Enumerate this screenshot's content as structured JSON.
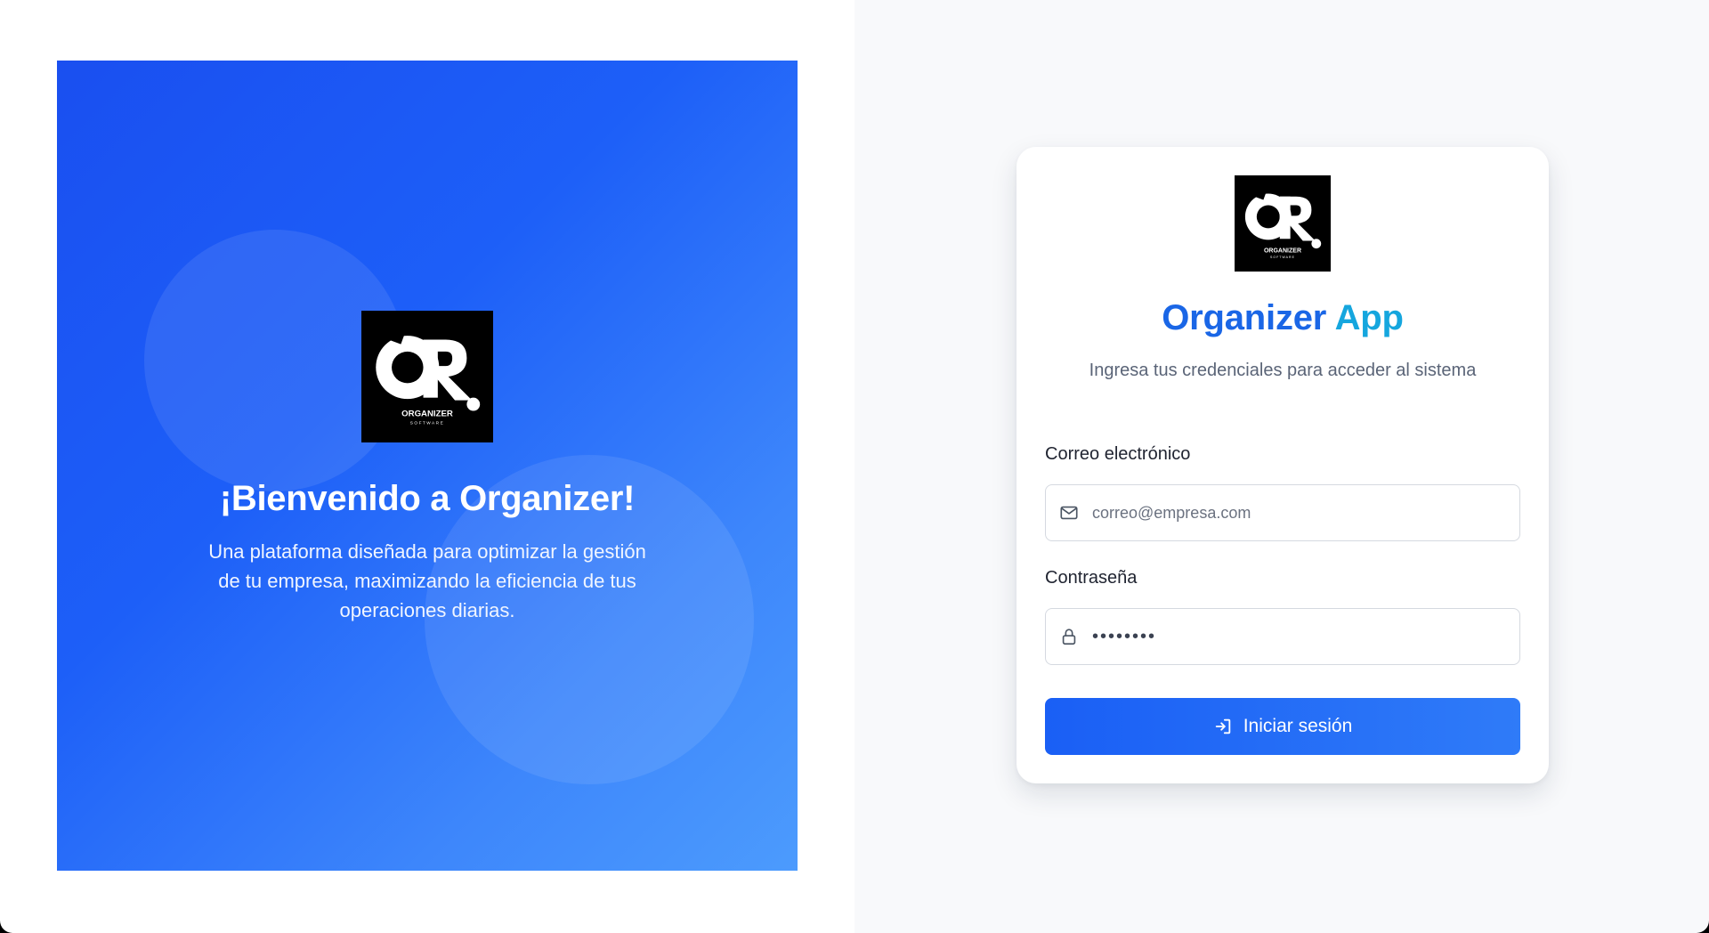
{
  "hero": {
    "logo": {
      "icon": "organizer-logo",
      "letters": "OR",
      "wordmark": "ORGANIZER",
      "tagline": "SOFTWARE"
    },
    "title": "¡Bienvenido a Organizer!",
    "description": "Una plataforma diseñada para optimizar la gestión de tu empresa, maximizando la eficiencia de tus operaciones diarias."
  },
  "login": {
    "logo": {
      "icon": "organizer-logo",
      "letters": "OR",
      "wordmark": "ORGANIZER",
      "tagline": "SOFTWARE"
    },
    "title_part1": "Organizer",
    "title_part2": "App",
    "subtitle": "Ingresa tus credenciales para acceder al sistema",
    "email": {
      "label": "Correo electrónico",
      "placeholder": "correo@empresa.com",
      "value": "",
      "icon": "mail-icon"
    },
    "password": {
      "label": "Contraseña",
      "value": "••••••••",
      "icon": "lock-icon"
    },
    "submit": {
      "label": "Iniciar sesión",
      "icon": "login-icon"
    }
  },
  "colors": {
    "brand_blue": "#1a66e6",
    "brand_cyan": "#15a6de",
    "button": "#1a5ff5",
    "hero_gradient_start": "#1a4ff0",
    "hero_gradient_end": "#4c9bfd"
  }
}
